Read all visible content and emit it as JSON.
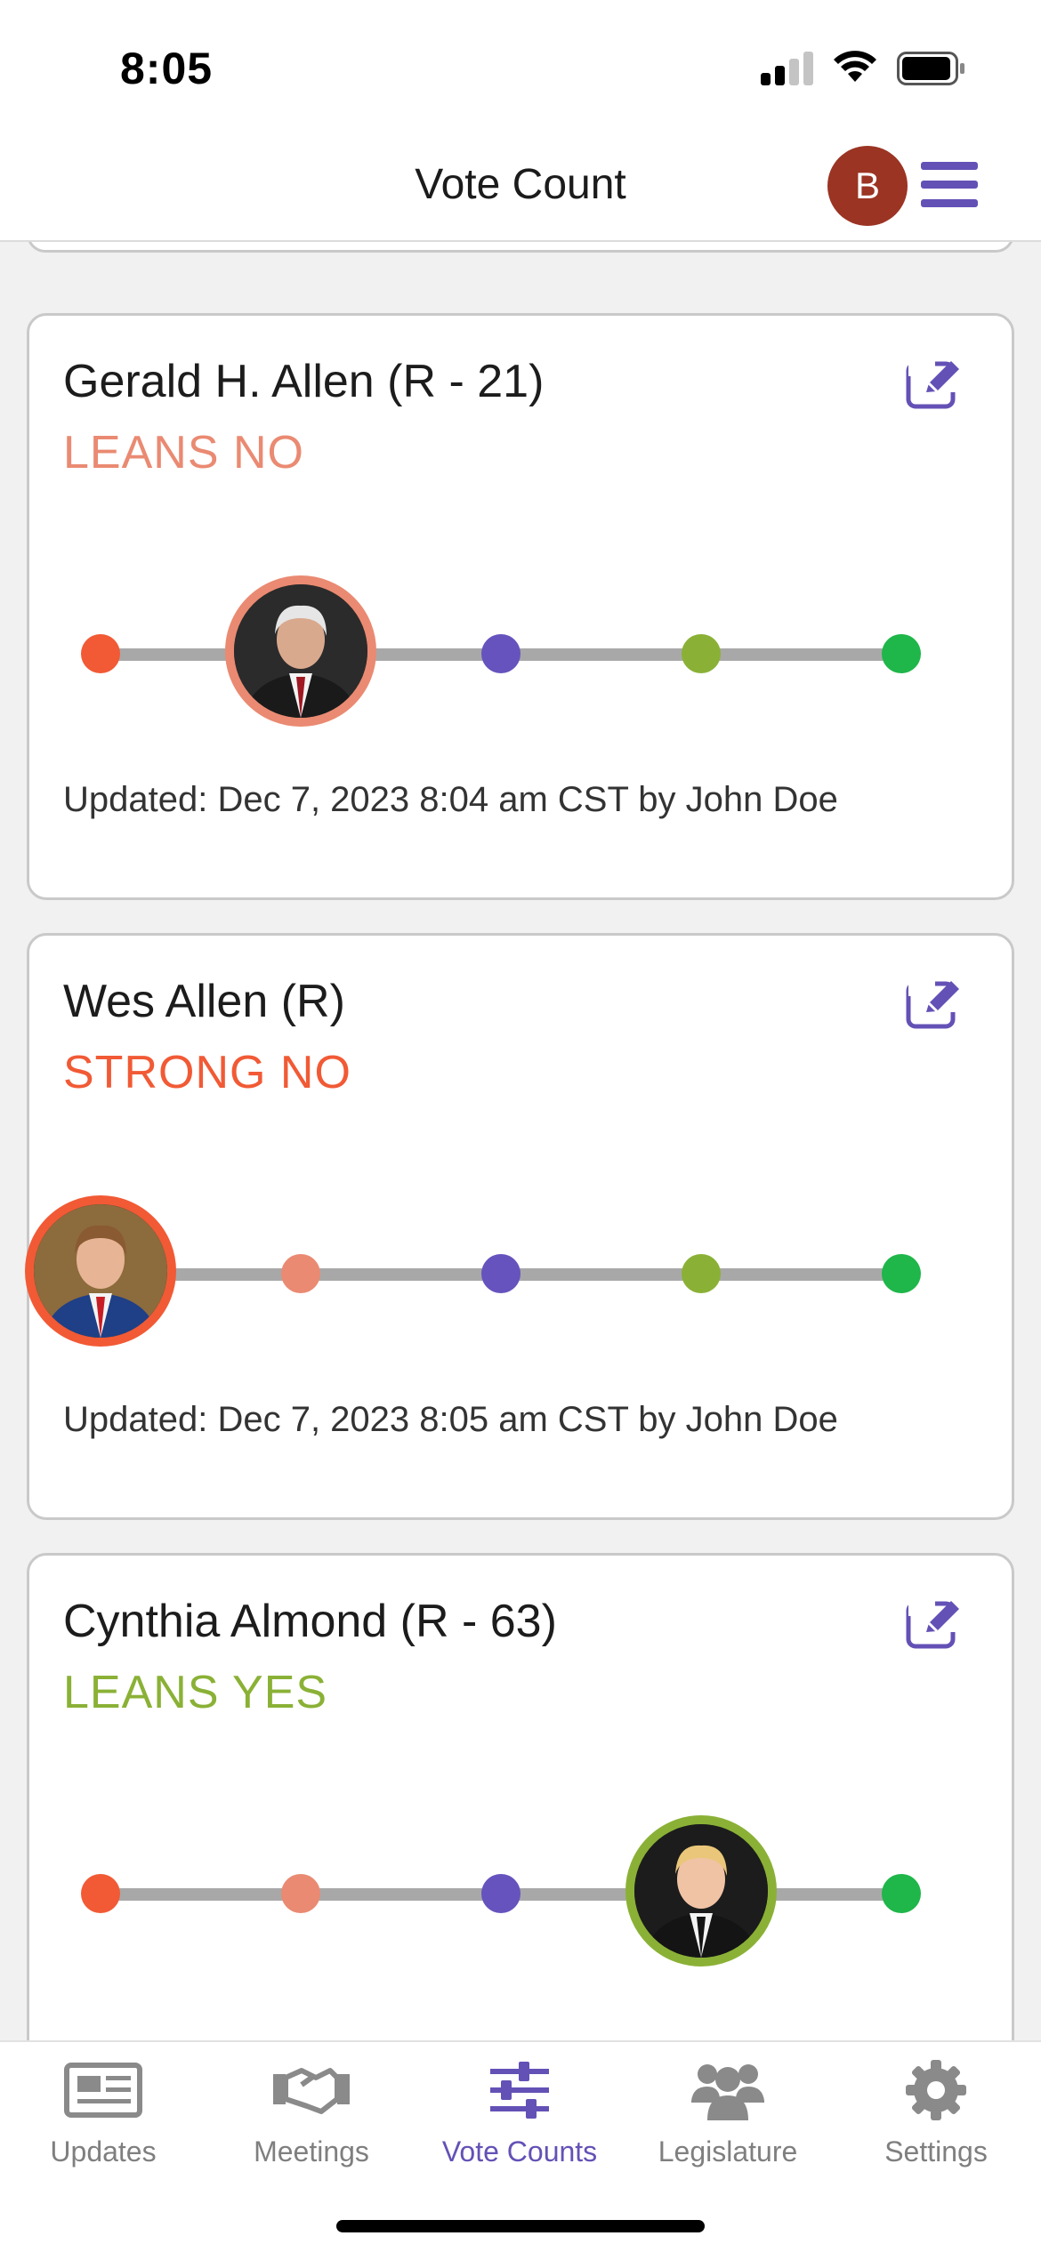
{
  "status_bar": {
    "time": "8:05"
  },
  "header": {
    "title": "Vote Count",
    "avatar_initial": "B"
  },
  "cards": [
    {
      "name": "Gerald H. Allen (R - 21)",
      "status": "LEANS NO",
      "status_color": "#ea8a72",
      "position": 2,
      "updated": "Updated: Dec 7, 2023 8:04 am CST by John Doe"
    },
    {
      "name": "Wes Allen (R)",
      "status": "STRONG NO",
      "status_color": "#f15a35",
      "position": 1,
      "updated": "Updated: Dec 7, 2023 8:05 am CST by John Doe"
    },
    {
      "name": "Cynthia Almond (R - 63)",
      "status": "LEANS YES",
      "status_color": "#8ab136",
      "position": 4,
      "updated": ""
    }
  ],
  "scale_colors": [
    "#f15a35",
    "#ea8a72",
    "#6653bd",
    "#8ab136",
    "#1fb64a"
  ],
  "tabs": [
    {
      "label": "Updates",
      "icon": "newspaper-icon"
    },
    {
      "label": "Meetings",
      "icon": "handshake-icon"
    },
    {
      "label": "Vote Counts",
      "icon": "sliders-icon",
      "active": true
    },
    {
      "label": "Legislature",
      "icon": "people-group-icon"
    },
    {
      "label": "Settings",
      "icon": "gear-icon"
    }
  ],
  "colors": {
    "accent": "#6451b6",
    "avatar_bg": "#9b3423"
  }
}
